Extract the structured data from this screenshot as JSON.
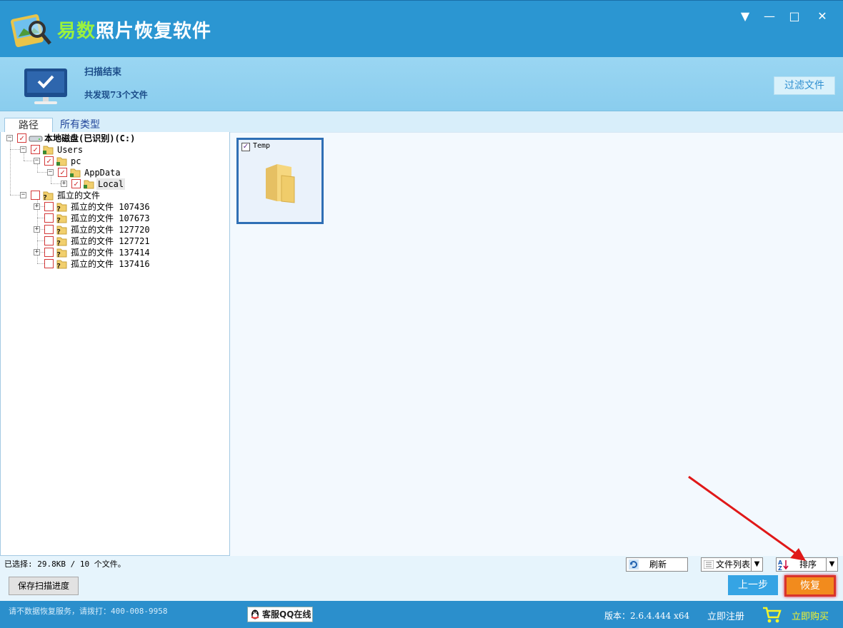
{
  "window": {
    "title": "易数照片恢复软件",
    "title_highlight": "易数",
    "title_rest": "照片恢复软件",
    "controls": {
      "menu": "▼",
      "minimize": "—",
      "maximize": "□",
      "close": "✕"
    }
  },
  "banner": {
    "status": "扫描结束",
    "summary": "共发现73个文件",
    "filter_button": "过滤文件"
  },
  "tabs": [
    {
      "label": "路径",
      "active": true
    },
    {
      "label": "所有类型",
      "active": false
    }
  ],
  "tree": {
    "root": {
      "label": "本地磁盘(已识别)(C:)",
      "checked": true
    },
    "users": {
      "label": "Users",
      "checked": true
    },
    "pc": {
      "label": "pc",
      "checked": true
    },
    "appdata": {
      "label": "AppData",
      "checked": true
    },
    "local": {
      "label": "Local",
      "checked": true
    },
    "orphan": {
      "label": "孤立的文件",
      "checked": false
    },
    "orphans": [
      {
        "label": "孤立的文件 107436",
        "expandable": true
      },
      {
        "label": "孤立的文件 107673",
        "expandable": false
      },
      {
        "label": "孤立的文件 127720",
        "expandable": true
      },
      {
        "label": "孤立的文件 127721",
        "expandable": false
      },
      {
        "label": "孤立的文件 137414",
        "expandable": true
      },
      {
        "label": "孤立的文件 137416",
        "expandable": false
      }
    ]
  },
  "content": {
    "items": [
      {
        "name": "Temp",
        "checked": true,
        "icon": "folder-icon"
      }
    ]
  },
  "status": {
    "selection": "已选择: 29.8KB / 10 个文件。",
    "refresh": "刷新",
    "view_mode": "文件列表",
    "sort": "排序",
    "save_progress": "保存扫描进度",
    "prev": "上一步",
    "recover": "恢复"
  },
  "footer": {
    "hotline": "请不数据恢复服务，请拨打：400-008-9958",
    "qq": "客服QQ在线",
    "version": "版本：2.6.4.444 x64",
    "register": "立即注册",
    "buy": "立即购买"
  },
  "colors": {
    "titlebar": "#2b96d2",
    "banner": "#9ad6f2",
    "accent_green": "#9bf23d",
    "recover": "#f28b1d",
    "highlight_border": "#d9342a"
  }
}
